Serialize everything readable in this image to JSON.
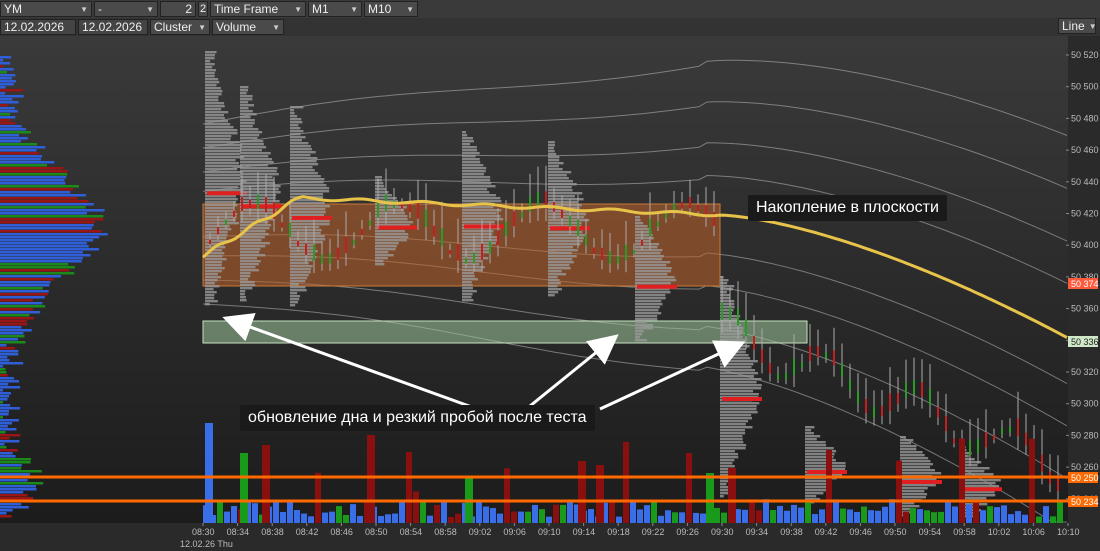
{
  "toolbar": {
    "symbol": "YM",
    "dash": "-",
    "number": "2",
    "number_suffix": "2",
    "time_frame_label": "Time Frame",
    "tf1": "M1",
    "tf2": "M10",
    "date_from": "12.02.2026",
    "date_to": "12.02.2026",
    "chart_type": "Cluster",
    "mode": "Volume",
    "line_mode": "Line"
  },
  "price_axis": {
    "ticks": [
      "50 520",
      "50 500",
      "50 480",
      "50 460",
      "50 440",
      "50 420",
      "50 400",
      "50 380",
      "50 360",
      "50 340",
      "50 320",
      "50 300",
      "50 280",
      "50 260",
      "50 240"
    ],
    "marker_50374": "50 374",
    "marker_50336": "50 336",
    "marker_50250": "50 250",
    "marker_50234": "50 234"
  },
  "time_axis": {
    "ticks": [
      "08:30",
      "08:34",
      "08:38",
      "08:42",
      "08:46",
      "08:50",
      "08:54",
      "08:58",
      "09:02",
      "09:06",
      "09:10",
      "09:14",
      "09:18",
      "09:22",
      "09:26",
      "09:30",
      "09:34",
      "09:38",
      "09:42",
      "09:46",
      "09:50",
      "09:54",
      "09:58",
      "10:02",
      "10:06",
      "10:10"
    ],
    "date_label": "12.02.26 Thu"
  },
  "annotations": {
    "accumulation": "Накопление в плоскости",
    "breakdown": "обновление дна и резкий пробой после теста"
  },
  "colors": {
    "zone_orange": "#c0632a",
    "zone_green": "#9fc79a",
    "vwap": "#e8c34a",
    "level_orange": "#ff6a00",
    "bar_blue": "#3a6ee8",
    "bar_green": "#1a9a1a",
    "bar_red": "#8a1010"
  }
}
